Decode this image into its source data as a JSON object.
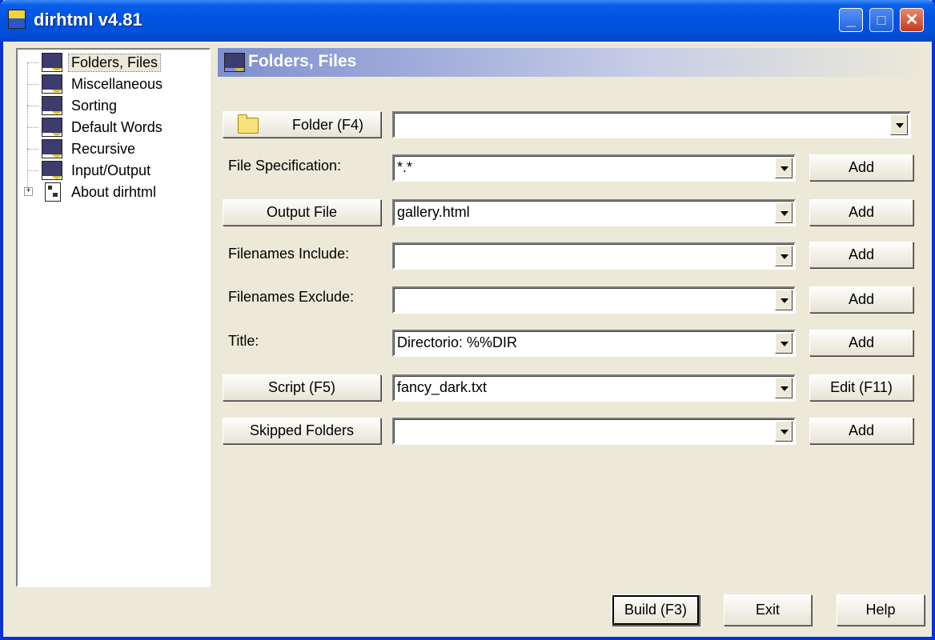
{
  "window": {
    "title": "dirhtml v4.81",
    "controls": {
      "minimize": "_",
      "maximize": "□",
      "close": "✕"
    }
  },
  "tree": {
    "items": [
      {
        "label": "Folders, Files",
        "icon": "settings-gear-icon",
        "selected": true
      },
      {
        "label": "Miscellaneous",
        "icon": "settings-gear-icon"
      },
      {
        "label": "Sorting",
        "icon": "settings-gear-icon"
      },
      {
        "label": "Default Words",
        "icon": "settings-gear-icon"
      },
      {
        "label": "Recursive",
        "icon": "settings-gear-icon"
      },
      {
        "label": "Input/Output",
        "icon": "settings-gear-icon"
      },
      {
        "label": "About dirhtml",
        "icon": "tree-structure-icon",
        "expandable": true
      }
    ],
    "expander": "+"
  },
  "panel": {
    "title": "Folders, Files",
    "rows": {
      "folder": {
        "button": "Folder (F4)",
        "value": ""
      },
      "filespec": {
        "label": "File Specification:",
        "value": "*.*",
        "action": "Add"
      },
      "output": {
        "button": "Output File",
        "value": "gallery.html",
        "action": "Add"
      },
      "include": {
        "label": "Filenames Include:",
        "value": "",
        "action": "Add"
      },
      "exclude": {
        "label": "Filenames Exclude:",
        "value": "",
        "action": "Add"
      },
      "title": {
        "label": "Title:",
        "value": "Directorio: %%DIR",
        "action": "Add"
      },
      "script": {
        "button": "Script (F5)",
        "value": "fancy_dark.txt",
        "action": "Edit (F11)"
      },
      "skipped": {
        "button": "Skipped Folders",
        "value": "",
        "action": "Add"
      }
    }
  },
  "footer": {
    "build": "Build (F3)",
    "exit": "Exit",
    "help": "Help"
  }
}
